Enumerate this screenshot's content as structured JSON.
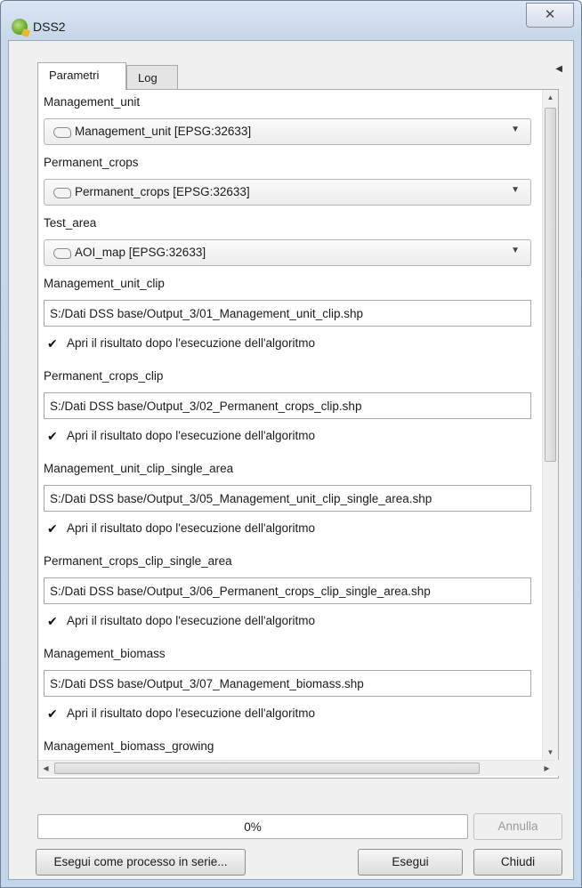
{
  "window": {
    "title": "DSS2",
    "close_glyph": "✕"
  },
  "tabs": [
    {
      "label": "Parametri",
      "active": true
    },
    {
      "label": "Log",
      "active": false
    }
  ],
  "params": {
    "management_unit_label": "Management_unit",
    "management_unit_value": "Management_unit [EPSG:32633]",
    "permanent_crops_label": "Permanent_crops",
    "permanent_crops_value": "Permanent_crops [EPSG:32633]",
    "test_area_label": "Test_area",
    "test_area_value": "AOI_map [EPSG:32633]",
    "outputs": [
      {
        "label": "Management_unit_clip",
        "path": "S:/Dati DSS base/Output_3/01_Management_unit_clip.shp",
        "open_after": true
      },
      {
        "label": "Permanent_crops_clip",
        "path": "S:/Dati DSS base/Output_3/02_Permanent_crops_clip.shp",
        "open_after": true
      },
      {
        "label": "Management_unit_clip_single_area",
        "path": "S:/Dati DSS base/Output_3/05_Management_unit_clip_single_area.shp",
        "open_after": true
      },
      {
        "label": "Permanent_crops_clip_single_area",
        "path": "S:/Dati DSS base/Output_3/06_Permanent_crops_clip_single_area.shp",
        "open_after": true
      },
      {
        "label": "Management_biomass",
        "path": "S:/Dati DSS base/Output_3/07_Management_biomass.shp",
        "open_after": true
      }
    ],
    "open_after_label": "Apri il risultato dopo l'esecuzione dell'algoritmo",
    "last_label": "Management_biomass_growing"
  },
  "progress": {
    "percent": 0,
    "text": "0%"
  },
  "buttons": {
    "cancel": "Annulla",
    "batch": "Esegui come processo in serie...",
    "run": "Esegui",
    "close": "Chiudi"
  },
  "icons": {
    "layer": "polygon-layer-icon",
    "check": "✔",
    "caret": "▼",
    "up": "▲",
    "down": "▼",
    "left": "◀",
    "right": "▶",
    "collapse": "◀"
  },
  "colors": {
    "accent": "#37b24a",
    "titlebar": "#c8d8ea"
  }
}
